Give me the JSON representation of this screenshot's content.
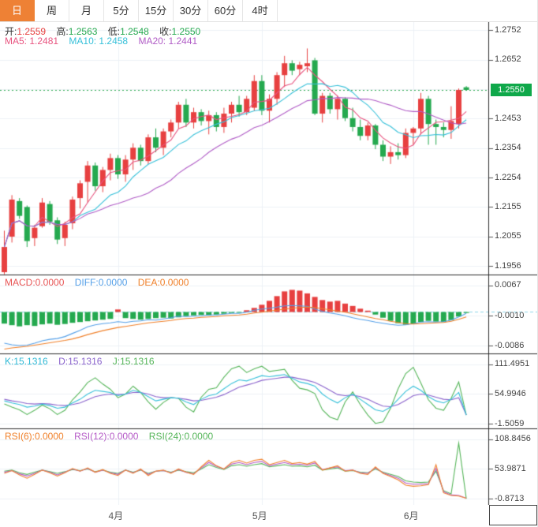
{
  "tabs": [
    {
      "label": "日",
      "active": true
    },
    {
      "label": "周",
      "active": false
    },
    {
      "label": "月",
      "active": false
    },
    {
      "label": "5分",
      "active": false
    },
    {
      "label": "15分",
      "active": false
    },
    {
      "label": "30分",
      "active": false
    },
    {
      "label": "60分",
      "active": false
    },
    {
      "label": "4时",
      "active": false
    }
  ],
  "overlay": {
    "ohlc": {
      "open_label": "开:",
      "open": "1.2559",
      "high_label": "高:",
      "high": "1.2563",
      "low_label": "低:",
      "low": "1.2548",
      "close_label": "收:",
      "close": "1.2550"
    },
    "ma": {
      "ma5": "MA5: 1.2481",
      "ma10": "MA10: 1.2458",
      "ma20": "MA20: 1.2441"
    },
    "macd": {
      "macd": "MACD:0.0000",
      "diff": "DIFF:0.0000",
      "dea": "DEA:0.0000"
    },
    "kdj": {
      "k": "K:15.1316",
      "d": "D:15.1316",
      "j": "J:15.1316"
    },
    "rsi": {
      "rsi6": "RSI(6):0.0000",
      "rsi12": "RSI(12):0.0000",
      "rsi24": "RSI(24):0.0000"
    }
  },
  "colors": {
    "up": "#e74040",
    "down": "#25a94f",
    "ma5": "#e8537f",
    "ma10": "#36c0d9",
    "ma20": "#b05cc6",
    "diff": "#55a0e8",
    "dea": "#f0812b",
    "k": "#36c0d9",
    "d": "#8a63cc",
    "j": "#55b559",
    "rsi6": "#f0812b",
    "rsi12": "#b55bc7",
    "rsi24": "#55b559",
    "grid": "#edf1f6",
    "panel_border": "#2b2b2b",
    "axis_text": "#444444",
    "tag_bg": "#0fa84a",
    "price_line": "#2aa94f",
    "macd_zero_line": "#8ed6e8",
    "tab_active": "#ee8135"
  },
  "chart_data": {
    "type": "candlestick+indicators",
    "x_axis": {
      "month_labels": [
        {
          "label": "4月",
          "index": 15
        },
        {
          "label": "5月",
          "index": 34
        },
        {
          "label": "6月",
          "index": 54
        }
      ]
    },
    "price_tag": {
      "value": 1.255,
      "label": "1.2550"
    },
    "candles": {
      "open": [
        1.1935,
        1.2055,
        1.2175,
        1.2155,
        1.205,
        1.209,
        1.2165,
        1.211,
        1.205,
        1.21,
        1.2185,
        1.224,
        1.2295,
        1.2225,
        1.228,
        1.232,
        1.2265,
        1.2315,
        1.2355,
        1.231,
        1.239,
        1.2355,
        1.241,
        1.244,
        1.25,
        1.244,
        1.2475,
        1.2445,
        1.2465,
        1.2425,
        1.247,
        1.25,
        1.2475,
        1.249,
        1.258,
        1.248,
        1.252,
        1.26,
        1.264,
        1.262,
        1.263,
        1.265,
        1.247,
        1.253,
        1.2485,
        1.252,
        1.2455,
        1.2425,
        1.2395,
        1.243,
        1.2365,
        1.2325,
        1.234,
        1.233,
        1.2405,
        1.242,
        1.252,
        1.2435,
        1.2425,
        1.2415,
        1.2435,
        1.2559
      ],
      "high": [
        1.2075,
        1.2195,
        1.2185,
        1.216,
        1.2095,
        1.2185,
        1.2175,
        1.212,
        1.2105,
        1.219,
        1.2245,
        1.231,
        1.2305,
        1.229,
        1.2335,
        1.233,
        1.233,
        1.237,
        1.2365,
        1.24,
        1.242,
        1.242,
        1.245,
        1.251,
        1.252,
        1.249,
        1.2485,
        1.248,
        1.2475,
        1.249,
        1.251,
        1.253,
        1.253,
        1.26,
        1.26,
        1.2535,
        1.261,
        1.2665,
        1.265,
        1.2645,
        1.269,
        1.2658,
        1.254,
        1.254,
        1.253,
        1.2525,
        1.249,
        1.245,
        1.244,
        1.2435,
        1.238,
        1.236,
        1.237,
        1.242,
        1.2425,
        1.254,
        1.253,
        1.245,
        1.244,
        1.2495,
        1.2555,
        1.2563
      ],
      "low": [
        1.1928,
        1.2035,
        1.2115,
        1.202,
        1.2023,
        1.2085,
        1.2095,
        1.203,
        1.2023,
        1.208,
        1.215,
        1.217,
        1.221,
        1.2205,
        1.2245,
        1.225,
        1.224,
        1.228,
        1.2295,
        1.23,
        1.234,
        1.233,
        1.239,
        1.242,
        1.2425,
        1.242,
        1.243,
        1.24,
        1.241,
        1.2405,
        1.244,
        1.246,
        1.2465,
        1.248,
        1.2465,
        1.244,
        1.25,
        1.256,
        1.26,
        1.26,
        1.261,
        1.2465,
        1.244,
        1.247,
        1.245,
        1.2445,
        1.241,
        1.238,
        1.238,
        1.235,
        1.231,
        1.23,
        1.2315,
        1.232,
        1.2365,
        1.24,
        1.2365,
        1.2365,
        1.239,
        1.2385,
        1.242,
        1.2548
      ],
      "close": [
        1.202,
        1.218,
        1.2125,
        1.204,
        1.2085,
        1.217,
        1.2105,
        1.2045,
        1.2095,
        1.218,
        1.2235,
        1.2295,
        1.2225,
        1.228,
        1.232,
        1.2265,
        1.2315,
        1.2355,
        1.231,
        1.239,
        1.2355,
        1.241,
        1.244,
        1.25,
        1.244,
        1.2475,
        1.2445,
        1.2465,
        1.2425,
        1.247,
        1.25,
        1.2475,
        1.252,
        1.258,
        1.248,
        1.252,
        1.26,
        1.264,
        1.2615,
        1.2635,
        1.264,
        1.247,
        1.253,
        1.2485,
        1.252,
        1.2455,
        1.2425,
        1.2395,
        1.243,
        1.2365,
        1.2325,
        1.234,
        1.233,
        1.2405,
        1.242,
        1.252,
        1.2435,
        1.2425,
        1.2415,
        1.2445,
        1.255,
        1.255
      ]
    },
    "ma_windows": [
      5,
      10,
      20
    ],
    "panels": {
      "main": {
        "range": [
          1.1927,
          1.2779
        ],
        "current_price": 1.255,
        "ticks": [
          {
            "v": 1.2752,
            "label": "1.2752"
          },
          {
            "v": 1.2652,
            "label": "1.2652"
          },
          {
            "v": 1.2553,
            "label": ""
          },
          {
            "v": 1.2453,
            "label": "1.2453"
          },
          {
            "v": 1.2354,
            "label": "1.2354"
          },
          {
            "v": 1.2254,
            "label": "1.2254"
          },
          {
            "v": 1.2155,
            "label": "1.2155"
          },
          {
            "v": 1.2055,
            "label": "1.2055"
          },
          {
            "v": 1.1956,
            "label": "1.1956"
          }
        ]
      },
      "macd": {
        "range": [
          -0.0106,
          0.0095
        ],
        "ticks": [
          {
            "v": 0.0067,
            "label": "0.0067"
          },
          {
            "v": -0.001,
            "label": "-0.0010"
          },
          {
            "v": -0.0086,
            "label": "-0.0086"
          }
        ],
        "hist": [
          -0.003,
          -0.0034,
          -0.0037,
          -0.0034,
          -0.0036,
          -0.0032,
          -0.003,
          -0.0033,
          -0.0031,
          -0.0028,
          -0.0026,
          -0.0024,
          -0.0022,
          -0.002,
          -0.0018,
          0.0006,
          -0.0016,
          -0.0018,
          -0.002,
          -0.0018,
          -0.0016,
          -0.0015,
          -0.0017,
          -0.0014,
          -0.0011,
          -0.0009,
          -0.0008,
          -0.0009,
          -0.0007,
          -0.0005,
          -0.0003,
          -0.0002,
          0.0004,
          0.001,
          0.0018,
          0.0028,
          0.004,
          0.0052,
          0.0056,
          0.0054,
          0.0047,
          0.0038,
          0.003,
          0.0026,
          0.0028,
          0.0021,
          0.0015,
          0.0008,
          0.0003,
          -0.0007,
          -0.0015,
          -0.0023,
          -0.0029,
          -0.0033,
          -0.003,
          -0.0026,
          -0.0023,
          -0.0025,
          -0.0026,
          -0.0021,
          -0.0012,
          -0.0003
        ],
        "diff": [
          -0.008,
          -0.0084,
          -0.0086,
          -0.0085,
          -0.008,
          -0.0074,
          -0.007,
          -0.0068,
          -0.0063,
          -0.0055,
          -0.0047,
          -0.0038,
          -0.0033,
          -0.003,
          -0.0028,
          -0.0025,
          -0.0027,
          -0.0024,
          -0.0023,
          -0.002,
          -0.0021,
          -0.0018,
          -0.0015,
          -0.0011,
          -0.0012,
          -0.0011,
          -0.001,
          -0.0008,
          -0.0008,
          -0.0006,
          -0.0004,
          -0.0004,
          -0.0001,
          0.0004,
          0.0007,
          0.0009,
          0.0012,
          0.0015,
          0.0016,
          0.0015,
          0.0014,
          0.0007,
          0.0001,
          -0.0003,
          -0.0006,
          -0.001,
          -0.0015,
          -0.0019,
          -0.0022,
          -0.0026,
          -0.0029,
          -0.0032,
          -0.0034,
          -0.0033,
          -0.003,
          -0.0026,
          -0.0025,
          -0.0026,
          -0.0025,
          -0.0021,
          -0.0013,
          -0.0004
        ],
        "dea": [
          -0.0095,
          -0.0092,
          -0.009,
          -0.0088,
          -0.0085,
          -0.0082,
          -0.0079,
          -0.0076,
          -0.0073,
          -0.0069,
          -0.0064,
          -0.0058,
          -0.0053,
          -0.0048,
          -0.0044,
          -0.004,
          -0.0037,
          -0.0034,
          -0.0031,
          -0.0028,
          -0.0026,
          -0.0024,
          -0.0022,
          -0.0019,
          -0.0017,
          -0.0016,
          -0.0014,
          -0.0013,
          -0.0012,
          -0.001,
          -0.0009,
          -0.0008,
          -0.0006,
          -0.0003,
          -0.0001,
          0.0002,
          0.0004,
          0.0007,
          0.0009,
          0.0011,
          0.0012,
          0.0011,
          0.0008,
          0.0005,
          0.0002,
          -0.0001,
          -0.0005,
          -0.0009,
          -0.0013,
          -0.0017,
          -0.002,
          -0.0024,
          -0.0027,
          -0.003,
          -0.0031,
          -0.003,
          -0.0029,
          -0.0028,
          -0.0027,
          -0.0024,
          -0.0019,
          -0.0013
        ]
      },
      "kdj": {
        "range": [
          -10.4,
          132.3
        ],
        "ticks": [
          {
            "v": 111.4951,
            "label": "111.4951"
          },
          {
            "v": 54.9946,
            "label": "54.9946"
          },
          {
            "v": -1.5059,
            "label": "-1.5059"
          }
        ],
        "k": [
          42,
          38,
          35,
          30,
          32,
          36,
          33,
          28,
          30,
          38,
          45,
          55,
          62,
          60,
          58,
          52,
          55,
          62,
          58,
          50,
          42,
          45,
          48,
          47,
          40,
          35,
          45,
          52,
          55,
          65,
          75,
          82,
          80,
          85,
          90,
          88,
          90,
          92,
          85,
          78,
          75,
          70,
          55,
          45,
          38,
          48,
          55,
          45,
          35,
          25,
          22,
          30,
          45,
          60,
          70,
          62,
          50,
          42,
          38,
          45,
          58,
          15.13
        ],
        "d": [
          45,
          42,
          40,
          37,
          36,
          37,
          36,
          34,
          33,
          35,
          38,
          44,
          50,
          53,
          55,
          54,
          55,
          58,
          58,
          55,
          50,
          48,
          48,
          47,
          45,
          42,
          43,
          46,
          49,
          54,
          61,
          68,
          72,
          76,
          81,
          83,
          85,
          87,
          87,
          84,
          81,
          77,
          70,
          62,
          54,
          52,
          53,
          50,
          45,
          38,
          32,
          31,
          35,
          43,
          52,
          55,
          53,
          49,
          45,
          44,
          48,
          15.13
        ],
        "j": [
          36,
          30,
          25,
          16,
          24,
          34,
          27,
          16,
          24,
          44,
          59,
          77,
          86,
          74,
          64,
          48,
          55,
          70,
          58,
          40,
          26,
          39,
          48,
          47,
          30,
          21,
          49,
          64,
          67,
          87,
          103,
          108,
          96,
          103,
          108,
          98,
          100,
          102,
          81,
          66,
          63,
          56,
          25,
          11,
          6,
          40,
          59,
          35,
          15,
          -1,
          2,
          28,
          65,
          94,
          106,
          76,
          44,
          28,
          24,
          47,
          78,
          15.13
        ]
      },
      "rsi": {
        "range": [
          -12.4,
          129.1
        ],
        "ticks": [
          {
            "v": 108.8456,
            "label": "108.8456"
          },
          {
            "v": 53.9871,
            "label": "53.9871"
          },
          {
            "v": -0.8713,
            "label": "-0.8713"
          }
        ],
        "rsi6": [
          46,
          51,
          43,
          37,
          44,
          52,
          47,
          41,
          47,
          55,
          50,
          56,
          48,
          53,
          46,
          42,
          52,
          46,
          54,
          42,
          50,
          52,
          46,
          54,
          48,
          44,
          58,
          70,
          60,
          54,
          66,
          70,
          65,
          70,
          72,
          62,
          66,
          70,
          64,
          66,
          63,
          68,
          52,
          56,
          60,
          50,
          52,
          46,
          44,
          58,
          46,
          40,
          34,
          24,
          22,
          23,
          25,
          62,
          10,
          5,
          4,
          0
        ],
        "rsi12": [
          48,
          51,
          45,
          41,
          46,
          52,
          48,
          43,
          48,
          54,
          50,
          55,
          48,
          52,
          47,
          44,
          52,
          47,
          53,
          44,
          50,
          51,
          47,
          53,
          48,
          45,
          56,
          66,
          59,
          54,
          63,
          66,
          62,
          66,
          68,
          60,
          63,
          66,
          62,
          63,
          61,
          65,
          53,
          56,
          58,
          51,
          52,
          47,
          46,
          56,
          47,
          42,
          37,
          28,
          26,
          26,
          27,
          55,
          12,
          6,
          5,
          0
        ],
        "rsi24": [
          50,
          52,
          47,
          44,
          48,
          52,
          49,
          46,
          49,
          53,
          51,
          54,
          49,
          52,
          48,
          46,
          52,
          48,
          52,
          46,
          50,
          51,
          48,
          52,
          49,
          47,
          54,
          62,
          57,
          53,
          60,
          62,
          59,
          62,
          64,
          58,
          60,
          62,
          59,
          60,
          58,
          61,
          52,
          54,
          56,
          50,
          51,
          48,
          47,
          54,
          48,
          44,
          40,
          32,
          30,
          29,
          30,
          50,
          14,
          8,
          102,
          -0.87
        ]
      }
    }
  }
}
